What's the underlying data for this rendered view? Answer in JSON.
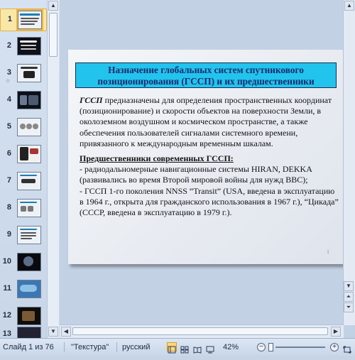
{
  "thumbnails": [
    {
      "number": "1",
      "selected": true
    },
    {
      "number": "2"
    },
    {
      "number": "3"
    },
    {
      "number": "4"
    },
    {
      "number": "5"
    },
    {
      "number": "6"
    },
    {
      "number": "7"
    },
    {
      "number": "8"
    },
    {
      "number": "9"
    },
    {
      "number": "10"
    },
    {
      "number": "11"
    },
    {
      "number": "12"
    },
    {
      "number": "13"
    }
  ],
  "slide": {
    "title": "Назначение глобальных систем спутникового позиционирования (ГССП) и их предшественники",
    "para1_lead": "ГССП",
    "para1_text": " предназначены для определения пространственных координат (позиционирование) и скорости объектов на поверхности Земли, в околоземном воздушном и космическом пространстве, а также обеспечения пользователей сигналами системного времени, привязанного к международным временным шкалам.",
    "para2_heading": "Предшественники современных ГССП:",
    "para2_line1": "- радиодальномерные навигационные системы HIRAN, DEKKA (развивались во время Второй мировой войны для нужд ВВС);",
    "para2_line2": "- ГССП 1-го поколения NNSS “Transit” (USA, введена в эксплуатацию в 1964 г., открыта для гражданского использования в 1967 г.), “Цикада” (СССР, введена в эксплуатацию в 1979 г.).",
    "page_number": "1"
  },
  "status_bar": {
    "slide_counter": "Слайд 1 из 76",
    "theme": "\"Текстура\"",
    "language": "русский",
    "zoom": "42%"
  },
  "colors": {
    "title_fill": "#22c4ee",
    "selection": "#f2b53b"
  }
}
